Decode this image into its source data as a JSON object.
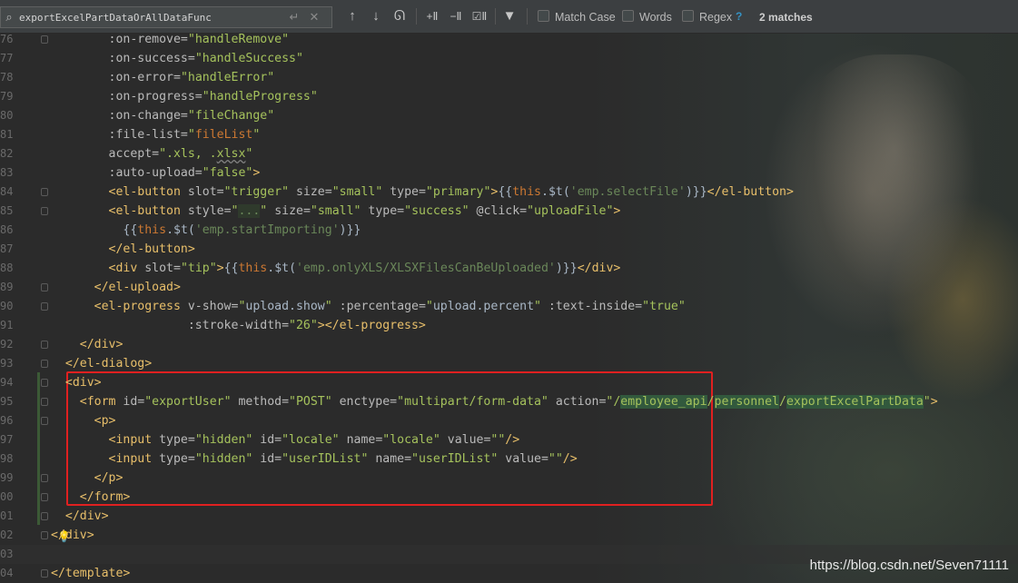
{
  "search": {
    "query": "exportExcelPartDataOrAllDataFunc",
    "match_case_label": "Match Case",
    "words_label": "Words",
    "regex_label": "Regex",
    "help": "?",
    "matches": "2 matches",
    "icons": [
      "search-icon",
      "enter-icon",
      "clear-icon",
      "arrow-up-icon",
      "arrow-down-icon",
      "find-all-icon",
      "add-occurrence-icon",
      "remove-occurrence-icon",
      "select-all-occurrences-icon",
      "filter-icon"
    ]
  },
  "editor": {
    "lines": [
      {
        "num": "76",
        "indent": "        ",
        "parts": [
          [
            "a",
            ":on-remove="
          ],
          [
            "s",
            "\"handleRemove\""
          ]
        ]
      },
      {
        "num": "77",
        "indent": "        ",
        "parts": [
          [
            "a",
            ":on-success="
          ],
          [
            "s",
            "\"handleSuccess\""
          ]
        ]
      },
      {
        "num": "78",
        "indent": "        ",
        "parts": [
          [
            "a",
            ":on-error="
          ],
          [
            "s",
            "\"handleError\""
          ]
        ]
      },
      {
        "num": "79",
        "indent": "        ",
        "parts": [
          [
            "a",
            ":on-progress="
          ],
          [
            "s",
            "\"handleProgress\""
          ]
        ]
      },
      {
        "num": "80",
        "indent": "        ",
        "parts": [
          [
            "a",
            ":on-change="
          ],
          [
            "s",
            "\"fileChange\""
          ]
        ]
      },
      {
        "num": "81",
        "indent": "        ",
        "parts": [
          [
            "a",
            ":file-list="
          ],
          [
            "s",
            "\""
          ],
          [
            "k",
            "fileList"
          ],
          [
            "s",
            "\""
          ]
        ]
      },
      {
        "num": "82",
        "indent": "        ",
        "parts": [
          [
            "a",
            "accept="
          ],
          [
            "s",
            "\".xls, ."
          ],
          [
            "su",
            "xlsx"
          ],
          [
            "s",
            "\""
          ]
        ]
      },
      {
        "num": "83",
        "indent": "        ",
        "parts": [
          [
            "a",
            ":auto-upload="
          ],
          [
            "s",
            "\"false\""
          ],
          [
            "t",
            ">"
          ]
        ]
      },
      {
        "num": "84",
        "indent": "        ",
        "parts": [
          [
            "t",
            "<el-button "
          ],
          [
            "a",
            "slot="
          ],
          [
            "s",
            "\"trigger\" "
          ],
          [
            "a",
            "size="
          ],
          [
            "s",
            "\"small\" "
          ],
          [
            "a",
            "type="
          ],
          [
            "s",
            "\"primary\""
          ],
          [
            "t",
            ">"
          ],
          [
            "b",
            "{{"
          ],
          [
            "k",
            "this"
          ],
          [
            "b",
            "."
          ],
          [
            "b",
            "$t("
          ],
          [
            "q",
            "'emp.selectFile'"
          ],
          [
            "b",
            ")}}"
          ],
          [
            "t",
            "</el-button>"
          ]
        ]
      },
      {
        "num": "85",
        "indent": "        ",
        "parts": [
          [
            "t",
            "<el-button "
          ],
          [
            "a",
            "style="
          ],
          [
            "s",
            "\""
          ],
          [
            "bt",
            "..."
          ],
          [
            "s",
            "\" "
          ],
          [
            "a",
            "size="
          ],
          [
            "s",
            "\"small\" "
          ],
          [
            "a",
            "type="
          ],
          [
            "s",
            "\"success\" "
          ],
          [
            "a",
            "@click="
          ],
          [
            "s",
            "\"uploadFile\""
          ],
          [
            "t",
            ">"
          ]
        ]
      },
      {
        "num": "86",
        "indent": "          ",
        "parts": [
          [
            "b",
            "{{"
          ],
          [
            "k",
            "this"
          ],
          [
            "b",
            "."
          ],
          [
            "b",
            "$t("
          ],
          [
            "q",
            "'emp.startImporting'"
          ],
          [
            "b",
            ")}}"
          ]
        ]
      },
      {
        "num": "87",
        "indent": "        ",
        "parts": [
          [
            "t",
            "</el-button>"
          ]
        ]
      },
      {
        "num": "88",
        "indent": "        ",
        "parts": [
          [
            "t",
            "<div "
          ],
          [
            "a",
            "slot="
          ],
          [
            "s",
            "\"tip\""
          ],
          [
            "t",
            ">"
          ],
          [
            "b",
            "{{"
          ],
          [
            "k",
            "this"
          ],
          [
            "b",
            "."
          ],
          [
            "b",
            "$t("
          ],
          [
            "q",
            "'emp.onlyXLS/XLSXFilesCanBeUploaded'"
          ],
          [
            "b",
            ")}}"
          ],
          [
            "t",
            "</div>"
          ]
        ]
      },
      {
        "num": "89",
        "indent": "      ",
        "parts": [
          [
            "t",
            "</el-upload>"
          ]
        ]
      },
      {
        "num": "90",
        "indent": "      ",
        "parts": [
          [
            "t",
            "<el-progress "
          ],
          [
            "a",
            "v-show="
          ],
          [
            "s",
            "\""
          ],
          [
            "b",
            "upload.show"
          ],
          [
            "s",
            "\" "
          ],
          [
            "a",
            ":percentage="
          ],
          [
            "s",
            "\""
          ],
          [
            "b",
            "upload.percent"
          ],
          [
            "s",
            "\" "
          ],
          [
            "a",
            ":text-inside="
          ],
          [
            "s",
            "\"true\""
          ]
        ]
      },
      {
        "num": "91",
        "indent": "                   ",
        "parts": [
          [
            "a",
            ":stroke-width="
          ],
          [
            "s",
            "\"26\""
          ],
          [
            "t",
            "></el-progress>"
          ]
        ]
      },
      {
        "num": "92",
        "indent": "    ",
        "parts": [
          [
            "t",
            "</div>"
          ]
        ]
      },
      {
        "num": "93",
        "indent": "  ",
        "parts": [
          [
            "t",
            "</el-dialog>"
          ]
        ]
      },
      {
        "num": "94",
        "indent": "  ",
        "parts": [
          [
            "t",
            "<div>"
          ]
        ]
      },
      {
        "num": "95",
        "indent": "    ",
        "parts": [
          [
            "t",
            "<form "
          ],
          [
            "a",
            "id="
          ],
          [
            "s",
            "\"exportUser\" "
          ],
          [
            "a",
            "method="
          ],
          [
            "s",
            "\"POST\" "
          ],
          [
            "a",
            "enctype="
          ],
          [
            "s",
            "\"multipart/form-data\" "
          ],
          [
            "a",
            "action="
          ],
          [
            "s",
            "\"/"
          ],
          [
            "h",
            "employee_api"
          ],
          [
            "s",
            "/"
          ],
          [
            "h",
            "personnel"
          ],
          [
            "s",
            "/"
          ],
          [
            "h",
            "exportExcelPartData"
          ],
          [
            "s",
            "\""
          ],
          [
            "t",
            ">"
          ]
        ]
      },
      {
        "num": "96",
        "indent": "      ",
        "parts": [
          [
            "t",
            "<p>"
          ]
        ]
      },
      {
        "num": "97",
        "indent": "        ",
        "parts": [
          [
            "t",
            "<input "
          ],
          [
            "a",
            "type="
          ],
          [
            "s",
            "\"hidden\" "
          ],
          [
            "a",
            "id="
          ],
          [
            "s",
            "\"locale\" "
          ],
          [
            "a",
            "name="
          ],
          [
            "s",
            "\"locale\" "
          ],
          [
            "a",
            "value="
          ],
          [
            "s",
            "\"\""
          ],
          [
            "t",
            "/>"
          ]
        ]
      },
      {
        "num": "98",
        "indent": "        ",
        "parts": [
          [
            "t",
            "<input "
          ],
          [
            "a",
            "type="
          ],
          [
            "s",
            "\"hidden\" "
          ],
          [
            "a",
            "id="
          ],
          [
            "s",
            "\"userIDList\" "
          ],
          [
            "a",
            "name="
          ],
          [
            "s",
            "\"userIDList\" "
          ],
          [
            "a",
            "value="
          ],
          [
            "s",
            "\"\""
          ],
          [
            "t",
            "/>"
          ]
        ]
      },
      {
        "num": "99",
        "indent": "      ",
        "parts": [
          [
            "t",
            "</p>"
          ]
        ]
      },
      {
        "num": "00",
        "indent": "    ",
        "parts": [
          [
            "t",
            "</form>"
          ]
        ]
      },
      {
        "num": "01",
        "indent": "  ",
        "parts": [
          [
            "t",
            "</div>"
          ]
        ]
      },
      {
        "num": "02",
        "indent": "",
        "parts": [
          [
            "t",
            "</div>"
          ]
        ]
      },
      {
        "num": "03",
        "indent": "",
        "parts": []
      },
      {
        "num": "04",
        "indent": "",
        "parts": [
          [
            "t",
            "</template>"
          ]
        ]
      }
    ]
  },
  "watermark": "https://blog.csdn.net/Seven71111",
  "colors": {
    "tag": "#e8bf6a",
    "attr": "#bababa",
    "string": "#a5c25c",
    "keyword": "#cc7832",
    "highlight_box": "#e02020"
  }
}
